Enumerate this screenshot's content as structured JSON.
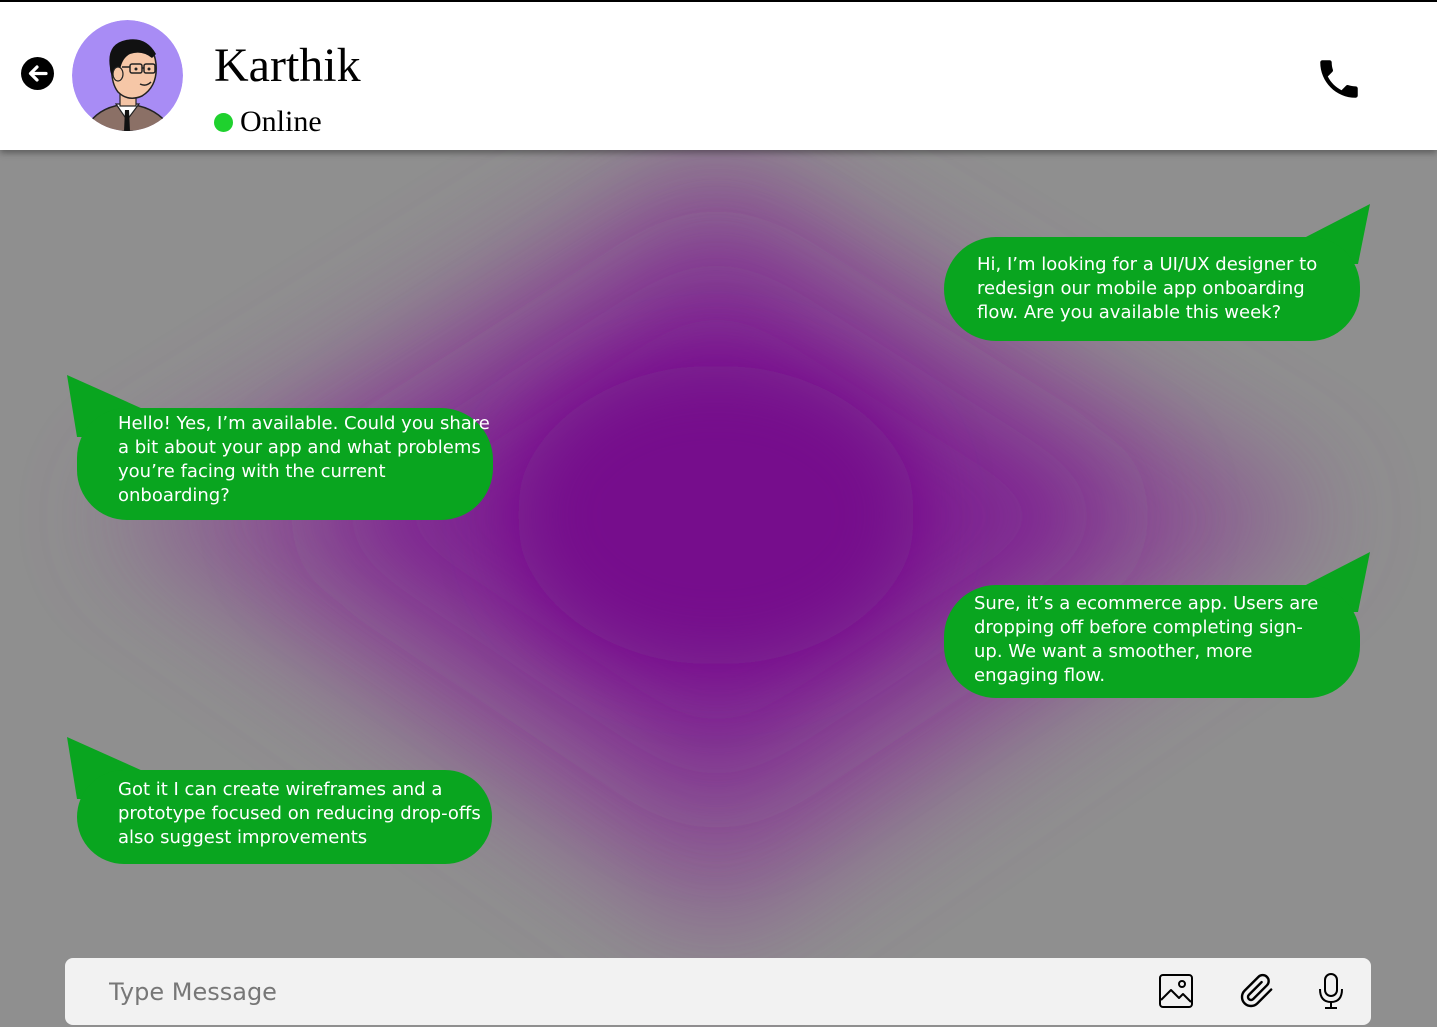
{
  "header": {
    "contact_name": "Karthik",
    "status": "Online",
    "status_color": "#1fd12e",
    "back_icon": "arrow-left-circle-icon",
    "call_icon": "phone-icon",
    "avatar": "avatar-illustration"
  },
  "colors": {
    "bubble": "#09a51f",
    "background": "#8f8f8f",
    "glow": "#7a078f"
  },
  "messages": [
    {
      "direction": "outgoing",
      "text": "Hi, I’m looking for a UI/UX designer to redesign our mobile app onboarding flow. Are you available this week?"
    },
    {
      "direction": "incoming",
      "text": "Hello! Yes, I’m available. Could you share a bit about your app and what problems you’re facing with the current onboarding?"
    },
    {
      "direction": "outgoing",
      "text": "Sure, it’s a ecommerce app. Users are dropping off before completing sign-up. We want a smoother, more engaging flow."
    },
    {
      "direction": "incoming",
      "text": "Got it  I can create wireframes and a prototype focused on reducing drop-offs also suggest improvements"
    }
  ],
  "composer": {
    "placeholder": "Type Message",
    "icons": [
      "image-icon",
      "paperclip-icon",
      "microphone-icon"
    ]
  }
}
